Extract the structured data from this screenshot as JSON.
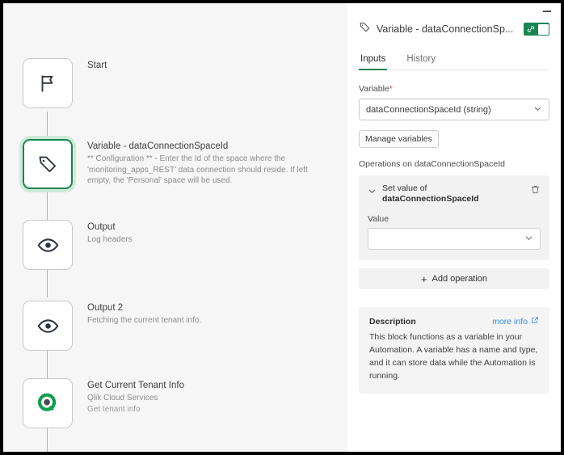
{
  "canvas": {
    "nodes": [
      {
        "icon": "flag-icon",
        "title": "Start",
        "subtitle": "",
        "subtitle2": "",
        "selected": false
      },
      {
        "icon": "tag-icon",
        "title": "Variable - dataConnectionSpaceId",
        "subtitle": "** Configuration ** - Enter the Id of the space where the 'monitoring_apps_REST' data connection should reside. If left empty, the 'Personal' space will be used.",
        "subtitle2": "",
        "selected": true
      },
      {
        "icon": "eye-icon",
        "title": "Output",
        "subtitle": "Log headers",
        "subtitle2": "",
        "selected": false
      },
      {
        "icon": "eye-icon",
        "title": "Output 2",
        "subtitle": "Fetching the current tenant info.",
        "subtitle2": "",
        "selected": false
      },
      {
        "icon": "qlik-logo-icon",
        "title": "Get Current Tenant Info",
        "subtitle": "Qlik Cloud Services",
        "subtitle2": "Get tenant info",
        "selected": false
      }
    ]
  },
  "panel": {
    "title": "Variable - dataConnectionSp...",
    "title_icon": "tag-icon",
    "minimize_label": "–",
    "toggle": {
      "state": "on",
      "icon": "link-icon"
    },
    "tabs": [
      {
        "label": "Inputs",
        "active": true
      },
      {
        "label": "History",
        "active": false
      }
    ],
    "variable": {
      "label": "Variable",
      "required_marker": "*",
      "value": "dataConnectionSpaceId (string)",
      "chevron": "chevron-down-icon"
    },
    "manage_variables_label": "Manage variables",
    "operations_label": "Operations on dataConnectionSpaceId",
    "operation": {
      "title_line1": "Set value of",
      "title_line2": "dataConnectionSpaceId",
      "value_label": "Value",
      "value": "",
      "value_placeholder": "",
      "delete_icon": "trash-icon",
      "collapse_icon": "chevron-down-icon"
    },
    "add_operation_label": "Add operation",
    "add_operation_plus": "+",
    "description": {
      "title": "Description",
      "link_label": "more info",
      "link_icon": "external-link-icon",
      "body": "This block functions as a variable in your Automation. A variable has a name and type, and it can store data while the Automation is running."
    }
  },
  "colors": {
    "accent_green": "#1a8553",
    "selected_halo": "#cfead9",
    "link_blue": "#3b8ce0",
    "canvas_bg": "#f6f6f6",
    "required_red": "#d53f3f"
  }
}
